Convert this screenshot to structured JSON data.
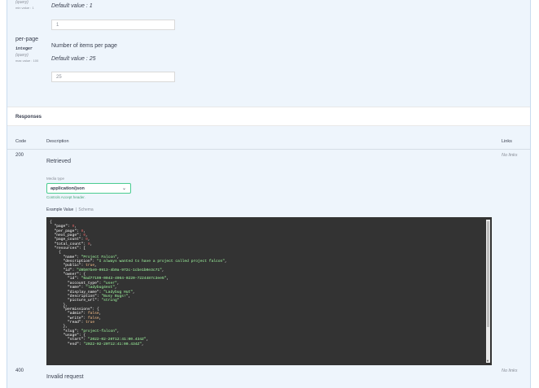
{
  "parameters": [
    {
      "location": "(query)",
      "meta": "min value : 1",
      "default_label": "Default value : 1",
      "input_value": "1"
    },
    {
      "name": "per-page",
      "type": "integer",
      "location": "(query)",
      "meta": "max value : 100",
      "description": "Number of items per page",
      "default_label": "Default value : 25",
      "input_value": "25"
    }
  ],
  "responses": {
    "title": "Responses",
    "columns": {
      "code": "Code",
      "description": "Description",
      "links": "Links"
    },
    "items": [
      {
        "code": "200",
        "description": "Retrieved",
        "links": "No links"
      },
      {
        "code": "400",
        "description": "Invalid request",
        "links": "No links"
      }
    ],
    "media_type_label": "Media type",
    "media_type_value": "application/json",
    "controls_label": "Controls Accept header.",
    "example_tab": "Example Value",
    "tab_separator": "|",
    "schema_tab": "Schema"
  },
  "example_json_lines": [
    [
      [
        "k",
        "{"
      ]
    ],
    [
      [
        "k",
        "  \"page\": "
      ],
      [
        "n",
        "0"
      ],
      [
        "k",
        ","
      ]
    ],
    [
      [
        "k",
        "  \"per_page\": "
      ],
      [
        "n",
        "0"
      ],
      [
        "k",
        ","
      ]
    ],
    [
      [
        "k",
        "  \"next_page\": "
      ],
      [
        "n",
        "0"
      ],
      [
        "k",
        ","
      ]
    ],
    [
      [
        "k",
        "  \"page_count\": "
      ],
      [
        "n",
        "0"
      ],
      [
        "k",
        ","
      ]
    ],
    [
      [
        "k",
        "  \"total_count\": "
      ],
      [
        "n",
        "0"
      ],
      [
        "k",
        ","
      ]
    ],
    [
      [
        "k",
        "  \"resources\": ["
      ]
    ],
    [
      [
        "k",
        "    {"
      ]
    ],
    [
      [
        "k",
        "      \"name\": "
      ],
      [
        "s",
        "\"Project Falcon\""
      ],
      [
        "k",
        ","
      ]
    ],
    [
      [
        "k",
        "      \"description\": "
      ],
      [
        "s",
        "\"I always wanted to have a project called project falcon\""
      ],
      [
        "k",
        ","
      ]
    ],
    [
      [
        "k",
        "      \"public\": "
      ],
      [
        "b",
        "true"
      ],
      [
        "k",
        ","
      ]
    ],
    [
      [
        "k",
        "      \"id\": "
      ],
      [
        "s",
        "\"d0b07be9-0913-4b9a-972c-1cbe1b0e3c71\""
      ],
      [
        "k",
        ","
      ]
    ],
    [
      [
        "k",
        "      \"owner\": {"
      ]
    ],
    [
      [
        "k",
        "        \"id\": "
      ],
      [
        "s",
        "\"0ad77199-0043-4964-0220-7224487c3ee5\""
      ],
      [
        "k",
        ","
      ]
    ],
    [
      [
        "k",
        "        \"account_type\": "
      ],
      [
        "s",
        "\"user\""
      ],
      [
        "k",
        ","
      ]
    ],
    [
      [
        "k",
        "        \"name\": "
      ],
      [
        "s",
        "\"ladybug4ext\""
      ],
      [
        "k",
        ","
      ]
    ],
    [
      [
        "k",
        "        \"display_name\": "
      ],
      [
        "s",
        "\"Ladybug Hut\""
      ],
      [
        "k",
        ","
      ]
    ],
    [
      [
        "k",
        "        \"description\": "
      ],
      [
        "s",
        "\"Busy Bugs!\""
      ],
      [
        "k",
        ","
      ]
    ],
    [
      [
        "k",
        "        \"picture_url\": "
      ],
      [
        "s",
        "\"string\""
      ]
    ],
    [
      [
        "k",
        "      },"
      ]
    ],
    [
      [
        "k",
        "      \"permissions\": {"
      ]
    ],
    [
      [
        "k",
        "        \"admin\": "
      ],
      [
        "b",
        "false"
      ],
      [
        "k",
        ","
      ]
    ],
    [
      [
        "k",
        "        \"write\": "
      ],
      [
        "b",
        "false"
      ],
      [
        "k",
        ","
      ]
    ],
    [
      [
        "k",
        "        \"read\": "
      ],
      [
        "b",
        "true"
      ]
    ],
    [
      [
        "k",
        "      },"
      ]
    ],
    [
      [
        "k",
        "      \"slug\": "
      ],
      [
        "s",
        "\"project-falcon\""
      ],
      [
        "k",
        ","
      ]
    ],
    [
      [
        "k",
        "      \"usage\": {"
      ]
    ],
    [
      [
        "k",
        "        \"start\": "
      ],
      [
        "s",
        "\"2022-02-20T12:41:00.434Z\""
      ],
      [
        "k",
        ","
      ]
    ],
    [
      [
        "k",
        "        \"end\": "
      ],
      [
        "s",
        "\"2022-02-20T12:41:00.434Z\""
      ],
      [
        "k",
        ","
      ]
    ]
  ],
  "colors": {
    "panel_bg": "#eef5fc",
    "code_bg": "#333333",
    "string_green": "#a2fca2",
    "number_red": "#d36363",
    "select_border": "#49cc90"
  }
}
